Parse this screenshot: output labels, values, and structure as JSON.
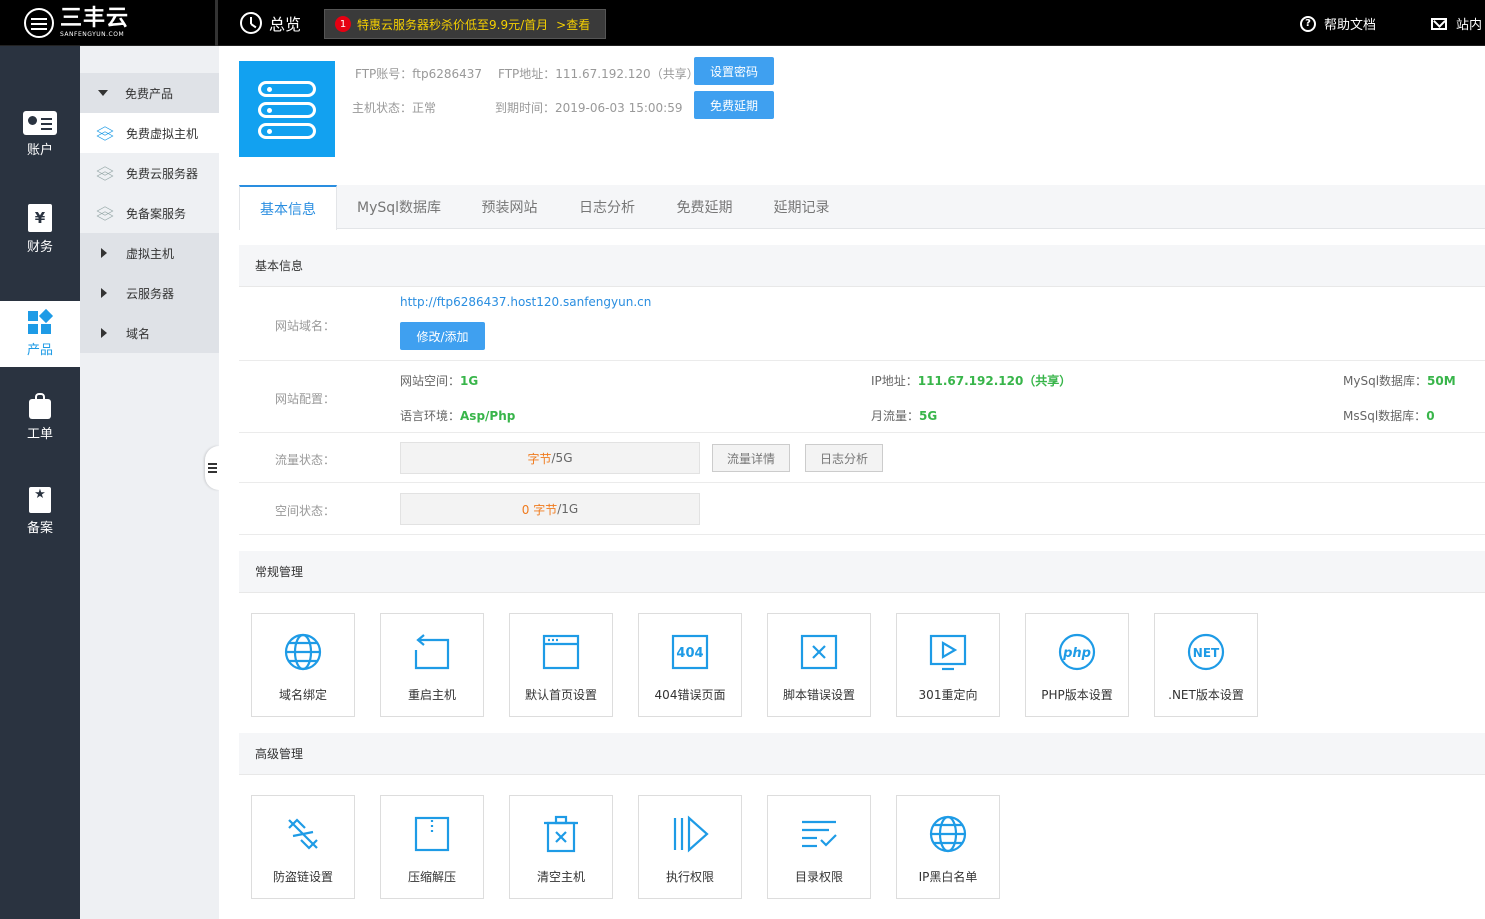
{
  "header": {
    "logo_cn": "三丰云",
    "logo_en": "SANFENGYUN.COM",
    "overview": "总览",
    "promo_badge": "1",
    "promo_text": "特惠云服务器秒杀价低至9.9元/首月",
    "promo_link": ">查看",
    "help": "帮助文档",
    "mail": "站内"
  },
  "rail": [
    {
      "label": "账户",
      "icon": "account-card-icon"
    },
    {
      "label": "财务",
      "icon": "yuan-icon",
      "glyph": "¥"
    },
    {
      "label": "产品",
      "icon": "product-grid-icon"
    },
    {
      "label": "工单",
      "icon": "ticket-bag-icon"
    },
    {
      "label": "备案",
      "icon": "record-star-icon",
      "glyph": "★"
    }
  ],
  "submenu": {
    "free_group": "免费产品",
    "free_vhost": "免费虚拟主机",
    "free_cloud": "免费云服务器",
    "free_beian": "免备案服务",
    "vhost": "虚拟主机",
    "cloud": "云服务器",
    "domain": "域名"
  },
  "host": {
    "ftp_account_label": "FTP账号：",
    "ftp_account": "ftp6286437",
    "ftp_addr_label": "FTP地址：",
    "ftp_addr": "111.67.192.120（共享）",
    "status_label": "主机状态：",
    "status": "正常",
    "expire_label": "到期时间：",
    "expire": "2019-06-03 15:00:59",
    "set_password": "设置密码",
    "extend": "免费延期"
  },
  "tabs": [
    "基本信息",
    "MySql数据库",
    "预装网站",
    "日志分析",
    "免费延期",
    "延期记录"
  ],
  "basic": {
    "title": "基本信息",
    "domain_label": "网站域名：",
    "domain_url": "http://ftp6286437.host120.sanfengyun.cn",
    "modify_button": "修改/添加",
    "config_label": "网站配置：",
    "space_label": "网站空间：",
    "space": "1G",
    "ip_label": "IP地址：",
    "ip": "111.67.192.120（共享）",
    "mysql_label": "MySql数据库：",
    "mysql": "50M",
    "lang_label": "语言环境：",
    "lang": "Asp/Php",
    "traffic_label": "月流量：",
    "traffic": "5G",
    "mssql_label": "MsSql数据库：",
    "mssql": "0",
    "flow_label": "流量状态：",
    "flow_used": "字节",
    "flow_total": "/5G",
    "flow_detail": "流量详情",
    "log_analysis": "日志分析",
    "disk_label": "空间状态：",
    "disk_used": "0 字节",
    "disk_total": "/1G"
  },
  "common": {
    "title": "常规管理",
    "tools": [
      "域名绑定",
      "重启主机",
      "默认首页设置",
      "404错误页面",
      "脚本错误设置",
      "301重定向",
      "PHP版本设置",
      ".NET版本设置"
    ],
    "icon_404": "404",
    "icon_php": "php",
    "icon_net": "NET"
  },
  "advanced": {
    "title": "高级管理",
    "tools": [
      "防盗链设置",
      "压缩解压",
      "清空主机",
      "执行权限",
      "目录权限",
      "IP黑白名单"
    ]
  },
  "colors": {
    "accent": "#1e9be6",
    "rail_bg": "#2a3340",
    "green_value": "#38b54a",
    "orange_value": "#f07b1e",
    "promo_yellow": "#f5d000"
  }
}
